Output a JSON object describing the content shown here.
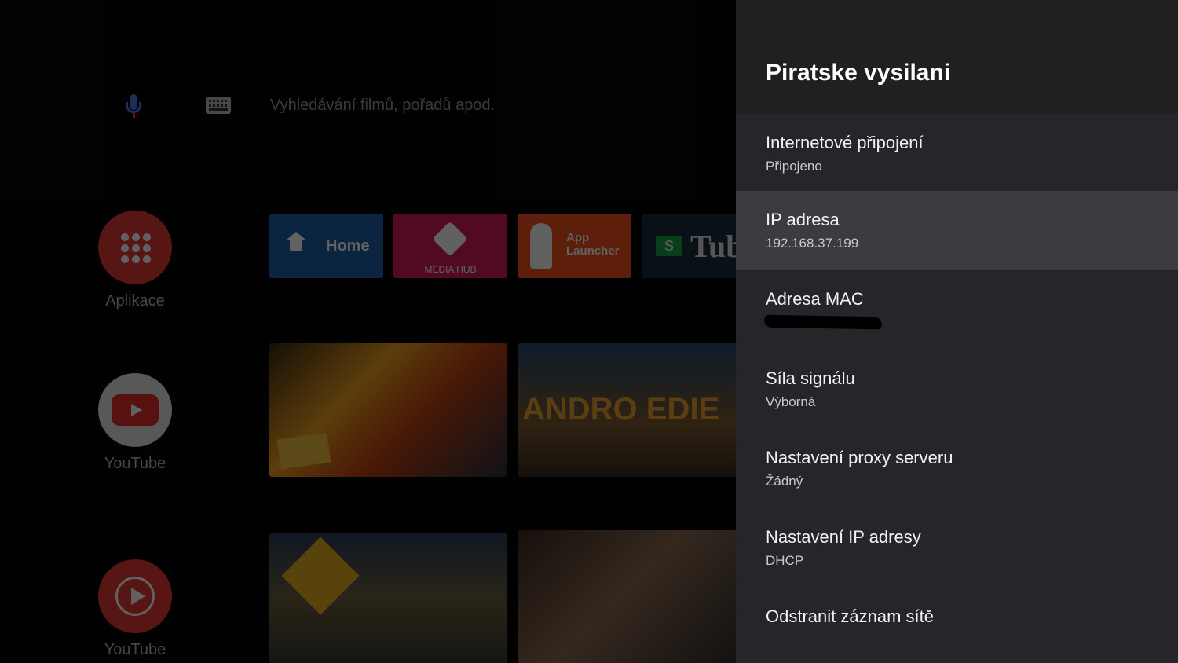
{
  "launcher": {
    "search_placeholder": "Vyhledávání filmů, pořadů apod.",
    "rail": [
      {
        "label": "Aplikace"
      },
      {
        "label": "YouTube"
      },
      {
        "label": "YouTube"
      }
    ],
    "tiles": {
      "home": "Home",
      "media": "MEDIA HUB",
      "app_launcher_line1": "App",
      "app_launcher_line2": "Launcher",
      "tube_s": "S",
      "tube_text": "Tub",
      "video_text": "ANDRO   EDIE"
    }
  },
  "panel": {
    "title": "Piratske vysilani",
    "items": [
      {
        "title": "Internetové připojení",
        "subtitle": "Připojeno",
        "focused": false
      },
      {
        "title": "IP adresa",
        "subtitle": "192.168.37.199",
        "focused": true
      },
      {
        "title": "Adresa MAC",
        "subtitle": "",
        "redacted": true,
        "focused": false
      },
      {
        "title": "Síla signálu",
        "subtitle": "Výborná",
        "focused": false
      },
      {
        "title": "Nastavení proxy serveru",
        "subtitle": "Žádný",
        "focused": false
      },
      {
        "title": "Nastavení IP adresy",
        "subtitle": "DHCP",
        "focused": false
      },
      {
        "title": "Odstranit záznam sítě",
        "subtitle": "",
        "focused": false
      }
    ]
  },
  "colors": {
    "panel_bg": "#26262a",
    "panel_header_bg": "#202023",
    "focused_item_bg": "#3b3b40"
  }
}
